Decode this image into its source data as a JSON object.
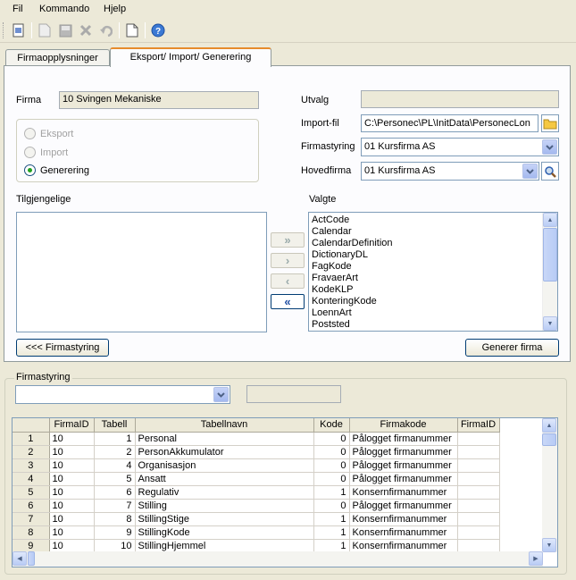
{
  "menu": {
    "items": [
      "Fil",
      "Kommando",
      "Hjelp"
    ]
  },
  "toolbar": {
    "buttons": [
      "new-document-icon",
      "page-icon",
      "save-icon",
      "delete-icon",
      "undo-icon",
      "blank-page-icon",
      "help-icon"
    ]
  },
  "tabs": [
    {
      "label": "Firmaopplysninger",
      "active": false
    },
    {
      "label": "Eksport/ Import/ Generering",
      "active": true
    }
  ],
  "form": {
    "firma_label": "Firma",
    "firma_value": "10 Svingen Mekaniske",
    "utvalg_label": "Utvalg",
    "utvalg_value": "",
    "importfil_label": "Import-fil",
    "importfil_value": "C:\\Personec\\PL\\InitData\\PersonecLon",
    "firmastyring_label": "Firmastyring",
    "firmastyring_value": "01 Kursfirma AS",
    "hovedfirma_label": "Hovedfirma",
    "hovedfirma_value": "01 Kursfirma AS",
    "mode_options": [
      {
        "label": "Eksport",
        "selected": false,
        "enabled": false
      },
      {
        "label": "Import",
        "selected": false,
        "enabled": false
      },
      {
        "label": "Generering",
        "selected": true,
        "enabled": true
      }
    ],
    "tilgjengelige_label": "Tilgjengelige",
    "tilgjengelige_items": [],
    "valgte_label": "Valgte",
    "valgte_items": [
      "ActCode",
      "Calendar",
      "CalendarDefinition",
      "DictionaryDL",
      "FagKode",
      "FravaerArt",
      "KodeKLP",
      "KonteringKode",
      "LoennArt",
      "Poststed"
    ],
    "move_buttons": [
      {
        "symbol": "»",
        "enabled": false
      },
      {
        "symbol": "›",
        "enabled": false
      },
      {
        "symbol": "‹",
        "enabled": false
      },
      {
        "symbol": "«",
        "enabled": true
      }
    ],
    "firmastyring_button": "<<< Firmastyring",
    "generer_button": "Generer firma"
  },
  "bottom": {
    "group_label": "Firmastyring",
    "combo_value": "",
    "ro_value": "",
    "grid": {
      "columns": [
        "",
        "FirmaID",
        "Tabell",
        "Tabellnavn",
        "Kode",
        "Firmakode",
        "FirmaID"
      ],
      "rows": [
        [
          "1",
          "10",
          "1",
          "Personal",
          "0",
          "Pålogget firmanummer",
          ""
        ],
        [
          "2",
          "10",
          "2",
          "PersonAkkumulator",
          "0",
          "Pålogget firmanummer",
          ""
        ],
        [
          "3",
          "10",
          "4",
          "Organisasjon",
          "0",
          "Pålogget firmanummer",
          ""
        ],
        [
          "4",
          "10",
          "5",
          "Ansatt",
          "0",
          "Pålogget firmanummer",
          ""
        ],
        [
          "5",
          "10",
          "6",
          "Regulativ",
          "1",
          "Konsernfirmanummer",
          ""
        ],
        [
          "6",
          "10",
          "7",
          "Stilling",
          "0",
          "Pålogget firmanummer",
          ""
        ],
        [
          "7",
          "10",
          "8",
          "StillingStige",
          "1",
          "Konsernfirmanummer",
          ""
        ],
        [
          "8",
          "10",
          "9",
          "StillingKode",
          "1",
          "Konsernfirmanummer",
          ""
        ],
        [
          "9",
          "10",
          "10",
          "StillingHjemmel",
          "1",
          "Konsernfirmanummer",
          ""
        ]
      ]
    }
  },
  "colors": {
    "accent_tab": "#e68b2c",
    "grid_header": "#ece9d8",
    "radio_selected": "#21a121"
  }
}
